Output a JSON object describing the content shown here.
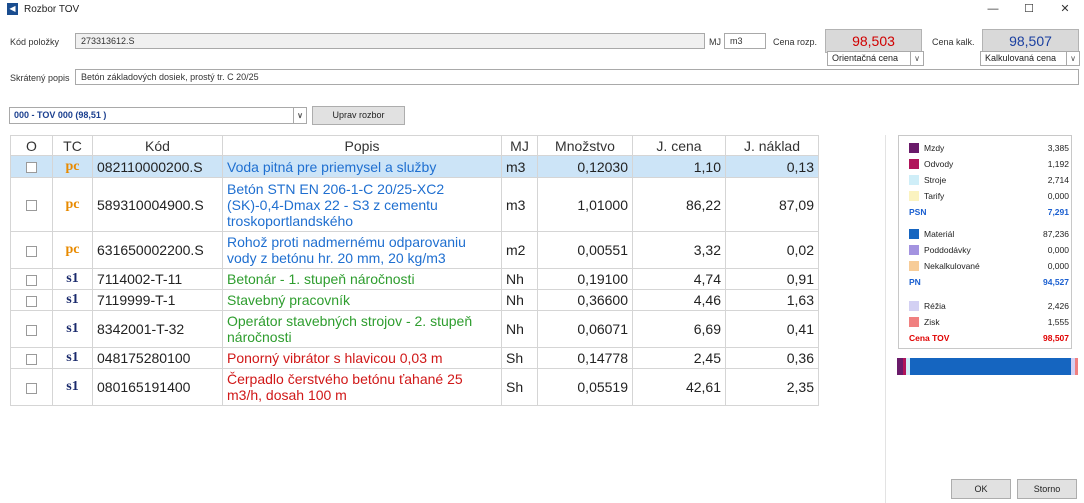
{
  "window": {
    "title": "Rozbor TOV",
    "minimize": "—",
    "maximize": "☐",
    "close": "✕"
  },
  "form": {
    "kod_label": "Kód položky",
    "kod_value": "273313612.S",
    "mj_label": "MJ",
    "mj_value": "m3",
    "cena_rozp_label": "Cena rozp.",
    "cena_rozp_value": "98,503",
    "cena_rozp_mode": "Orientačná cena",
    "cena_kalk_label": "Cena kalk.",
    "cena_kalk_value": "98,507",
    "cena_kalk_mode": "Kalkulovaná cena",
    "popis_label": "Skrátený popis",
    "popis_value": "Betón základových dosiek, prostý tr. C 20/25",
    "tov_select": "000 - TOV 000 (98,51 )",
    "uprav_button": "Uprav rozbor"
  },
  "table": {
    "columns": [
      "O",
      "TC",
      "Kód",
      "Popis",
      "MJ",
      "Množstvo",
      "J. cena",
      "J. náklad"
    ],
    "rows": [
      {
        "tc": "pc",
        "kod": "082110000200.S",
        "popis": "Voda pitná pre priemysel a služby",
        "mj": "m3",
        "mnozstvo": "0,12030",
        "jcena": "1,10",
        "jnaklad": "0,13"
      },
      {
        "tc": "pc",
        "kod": "589310004900.S",
        "popis": "Betón STN EN 206-1-C 20/25-XC2 (SK)-0,4-Dmax 22 - S3 z cementu troskoportlandského",
        "mj": "m3",
        "mnozstvo": "1,01000",
        "jcena": "86,22",
        "jnaklad": "87,09"
      },
      {
        "tc": "pc",
        "kod": "631650002200.S",
        "popis": "Rohož proti nadmernému odparovaniu vody z betónu hr. 20 mm, 20 kg/m3",
        "mj": "m2",
        "mnozstvo": "0,00551",
        "jcena": "3,32",
        "jnaklad": "0,02"
      },
      {
        "tc": "s1",
        "kod": "7114002-T-11",
        "popis": "Betonár - 1. stupeň náročnosti",
        "mj": "Nh",
        "mnozstvo": "0,19100",
        "jcena": "4,74",
        "jnaklad": "0,91"
      },
      {
        "tc": "s1",
        "kod": "7119999-T-1",
        "popis": "Stavebný pracovník",
        "mj": "Nh",
        "mnozstvo": "0,36600",
        "jcena": "4,46",
        "jnaklad": "1,63"
      },
      {
        "tc": "s1",
        "kod": "8342001-T-32",
        "popis": "Operátor stavebných strojov - 2. stupeň náročnosti",
        "mj": "Nh",
        "mnozstvo": "0,06071",
        "jcena": "6,69",
        "jnaklad": "0,41"
      },
      {
        "tc": "s1",
        "kod": "048175280100",
        "popis": "Ponorný vibrátor s hlavicou 0,03 m",
        "mj": "Sh",
        "mnozstvo": "0,14778",
        "jcena": "2,45",
        "jnaklad": "0,36"
      },
      {
        "tc": "s1",
        "kod": "080165191400",
        "popis": "Čerpadlo čerstvého betónu ťahané 25 m3/h, dosah 100 m",
        "mj": "Sh",
        "mnozstvo": "0,05519",
        "jcena": "42,61",
        "jnaklad": "2,35"
      }
    ]
  },
  "breakdown": {
    "items": [
      {
        "name": "Mzdy",
        "value": "3,385",
        "color": "#6a1b6a"
      },
      {
        "name": "Odvody",
        "value": "1,192",
        "color": "#b0145a"
      },
      {
        "name": "Stroje",
        "value": "2,714",
        "color": "#cfeef8"
      },
      {
        "name": "Tarify",
        "value": "0,000",
        "color": "#fbf3c0"
      },
      {
        "name": "PSN",
        "value": "7,291",
        "total": true,
        "color": "#1a5fd0"
      },
      {
        "name": "Materiál",
        "value": "87,236",
        "color": "#1565c0"
      },
      {
        "name": "Poddodávky",
        "value": "0,000",
        "color": "#a393e0"
      },
      {
        "name": "Nekalkulované",
        "value": "0,000",
        "color": "#f7cc98"
      },
      {
        "name": "PN",
        "value": "94,527",
        "total": true,
        "color": "#1a5fd0"
      },
      {
        "name": "Réžia",
        "value": "2,426",
        "color": "#d3d0f3"
      },
      {
        "name": "Zisk",
        "value": "1,555",
        "color": "#f08080"
      },
      {
        "name": "Cena TOV",
        "value": "98,507",
        "total": true,
        "color": "#e00000"
      }
    ]
  },
  "buttons": {
    "ok": "OK",
    "storno": "Storno"
  },
  "colors": {
    "red_price": "#d00000",
    "blue_price": "#1a3fa0",
    "pc_color": "#e88a00",
    "s1_color": "#1a2a6c"
  }
}
